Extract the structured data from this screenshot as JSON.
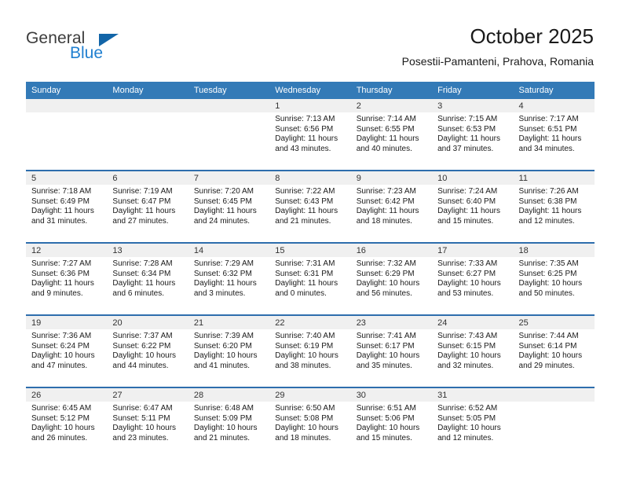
{
  "brand": {
    "name_part1": "General",
    "name_part2": "Blue"
  },
  "header": {
    "title": "October 2025",
    "subtitle": "Posestii-Pamanteni, Prahova, Romania"
  },
  "colors": {
    "header_band": "#337ab7",
    "week_separator": "#2e6ead",
    "daynum_band": "#f0f0f0",
    "brand_blue": "#1f7fd0",
    "brand_dark": "#3c3c3c"
  },
  "weekdays": [
    "Sunday",
    "Monday",
    "Tuesday",
    "Wednesday",
    "Thursday",
    "Friday",
    "Saturday"
  ],
  "weeks": [
    [
      {
        "day": "",
        "empty": true
      },
      {
        "day": "",
        "empty": true
      },
      {
        "day": "",
        "empty": true
      },
      {
        "day": "1",
        "sunrise": "Sunrise: 7:13 AM",
        "sunset": "Sunset: 6:56 PM",
        "daylight_line1": "Daylight: 11 hours",
        "daylight_line2": "and 43 minutes."
      },
      {
        "day": "2",
        "sunrise": "Sunrise: 7:14 AM",
        "sunset": "Sunset: 6:55 PM",
        "daylight_line1": "Daylight: 11 hours",
        "daylight_line2": "and 40 minutes."
      },
      {
        "day": "3",
        "sunrise": "Sunrise: 7:15 AM",
        "sunset": "Sunset: 6:53 PM",
        "daylight_line1": "Daylight: 11 hours",
        "daylight_line2": "and 37 minutes."
      },
      {
        "day": "4",
        "sunrise": "Sunrise: 7:17 AM",
        "sunset": "Sunset: 6:51 PM",
        "daylight_line1": "Daylight: 11 hours",
        "daylight_line2": "and 34 minutes."
      }
    ],
    [
      {
        "day": "5",
        "sunrise": "Sunrise: 7:18 AM",
        "sunset": "Sunset: 6:49 PM",
        "daylight_line1": "Daylight: 11 hours",
        "daylight_line2": "and 31 minutes."
      },
      {
        "day": "6",
        "sunrise": "Sunrise: 7:19 AM",
        "sunset": "Sunset: 6:47 PM",
        "daylight_line1": "Daylight: 11 hours",
        "daylight_line2": "and 27 minutes."
      },
      {
        "day": "7",
        "sunrise": "Sunrise: 7:20 AM",
        "sunset": "Sunset: 6:45 PM",
        "daylight_line1": "Daylight: 11 hours",
        "daylight_line2": "and 24 minutes."
      },
      {
        "day": "8",
        "sunrise": "Sunrise: 7:22 AM",
        "sunset": "Sunset: 6:43 PM",
        "daylight_line1": "Daylight: 11 hours",
        "daylight_line2": "and 21 minutes."
      },
      {
        "day": "9",
        "sunrise": "Sunrise: 7:23 AM",
        "sunset": "Sunset: 6:42 PM",
        "daylight_line1": "Daylight: 11 hours",
        "daylight_line2": "and 18 minutes."
      },
      {
        "day": "10",
        "sunrise": "Sunrise: 7:24 AM",
        "sunset": "Sunset: 6:40 PM",
        "daylight_line1": "Daylight: 11 hours",
        "daylight_line2": "and 15 minutes."
      },
      {
        "day": "11",
        "sunrise": "Sunrise: 7:26 AM",
        "sunset": "Sunset: 6:38 PM",
        "daylight_line1": "Daylight: 11 hours",
        "daylight_line2": "and 12 minutes."
      }
    ],
    [
      {
        "day": "12",
        "sunrise": "Sunrise: 7:27 AM",
        "sunset": "Sunset: 6:36 PM",
        "daylight_line1": "Daylight: 11 hours",
        "daylight_line2": "and 9 minutes."
      },
      {
        "day": "13",
        "sunrise": "Sunrise: 7:28 AM",
        "sunset": "Sunset: 6:34 PM",
        "daylight_line1": "Daylight: 11 hours",
        "daylight_line2": "and 6 minutes."
      },
      {
        "day": "14",
        "sunrise": "Sunrise: 7:29 AM",
        "sunset": "Sunset: 6:32 PM",
        "daylight_line1": "Daylight: 11 hours",
        "daylight_line2": "and 3 minutes."
      },
      {
        "day": "15",
        "sunrise": "Sunrise: 7:31 AM",
        "sunset": "Sunset: 6:31 PM",
        "daylight_line1": "Daylight: 11 hours",
        "daylight_line2": "and 0 minutes."
      },
      {
        "day": "16",
        "sunrise": "Sunrise: 7:32 AM",
        "sunset": "Sunset: 6:29 PM",
        "daylight_line1": "Daylight: 10 hours",
        "daylight_line2": "and 56 minutes."
      },
      {
        "day": "17",
        "sunrise": "Sunrise: 7:33 AM",
        "sunset": "Sunset: 6:27 PM",
        "daylight_line1": "Daylight: 10 hours",
        "daylight_line2": "and 53 minutes."
      },
      {
        "day": "18",
        "sunrise": "Sunrise: 7:35 AM",
        "sunset": "Sunset: 6:25 PM",
        "daylight_line1": "Daylight: 10 hours",
        "daylight_line2": "and 50 minutes."
      }
    ],
    [
      {
        "day": "19",
        "sunrise": "Sunrise: 7:36 AM",
        "sunset": "Sunset: 6:24 PM",
        "daylight_line1": "Daylight: 10 hours",
        "daylight_line2": "and 47 minutes."
      },
      {
        "day": "20",
        "sunrise": "Sunrise: 7:37 AM",
        "sunset": "Sunset: 6:22 PM",
        "daylight_line1": "Daylight: 10 hours",
        "daylight_line2": "and 44 minutes."
      },
      {
        "day": "21",
        "sunrise": "Sunrise: 7:39 AM",
        "sunset": "Sunset: 6:20 PM",
        "daylight_line1": "Daylight: 10 hours",
        "daylight_line2": "and 41 minutes."
      },
      {
        "day": "22",
        "sunrise": "Sunrise: 7:40 AM",
        "sunset": "Sunset: 6:19 PM",
        "daylight_line1": "Daylight: 10 hours",
        "daylight_line2": "and 38 minutes."
      },
      {
        "day": "23",
        "sunrise": "Sunrise: 7:41 AM",
        "sunset": "Sunset: 6:17 PM",
        "daylight_line1": "Daylight: 10 hours",
        "daylight_line2": "and 35 minutes."
      },
      {
        "day": "24",
        "sunrise": "Sunrise: 7:43 AM",
        "sunset": "Sunset: 6:15 PM",
        "daylight_line1": "Daylight: 10 hours",
        "daylight_line2": "and 32 minutes."
      },
      {
        "day": "25",
        "sunrise": "Sunrise: 7:44 AM",
        "sunset": "Sunset: 6:14 PM",
        "daylight_line1": "Daylight: 10 hours",
        "daylight_line2": "and 29 minutes."
      }
    ],
    [
      {
        "day": "26",
        "sunrise": "Sunrise: 6:45 AM",
        "sunset": "Sunset: 5:12 PM",
        "daylight_line1": "Daylight: 10 hours",
        "daylight_line2": "and 26 minutes."
      },
      {
        "day": "27",
        "sunrise": "Sunrise: 6:47 AM",
        "sunset": "Sunset: 5:11 PM",
        "daylight_line1": "Daylight: 10 hours",
        "daylight_line2": "and 23 minutes."
      },
      {
        "day": "28",
        "sunrise": "Sunrise: 6:48 AM",
        "sunset": "Sunset: 5:09 PM",
        "daylight_line1": "Daylight: 10 hours",
        "daylight_line2": "and 21 minutes."
      },
      {
        "day": "29",
        "sunrise": "Sunrise: 6:50 AM",
        "sunset": "Sunset: 5:08 PM",
        "daylight_line1": "Daylight: 10 hours",
        "daylight_line2": "and 18 minutes."
      },
      {
        "day": "30",
        "sunrise": "Sunrise: 6:51 AM",
        "sunset": "Sunset: 5:06 PM",
        "daylight_line1": "Daylight: 10 hours",
        "daylight_line2": "and 15 minutes."
      },
      {
        "day": "31",
        "sunrise": "Sunrise: 6:52 AM",
        "sunset": "Sunset: 5:05 PM",
        "daylight_line1": "Daylight: 10 hours",
        "daylight_line2": "and 12 minutes."
      },
      {
        "day": "",
        "empty": true
      }
    ]
  ]
}
